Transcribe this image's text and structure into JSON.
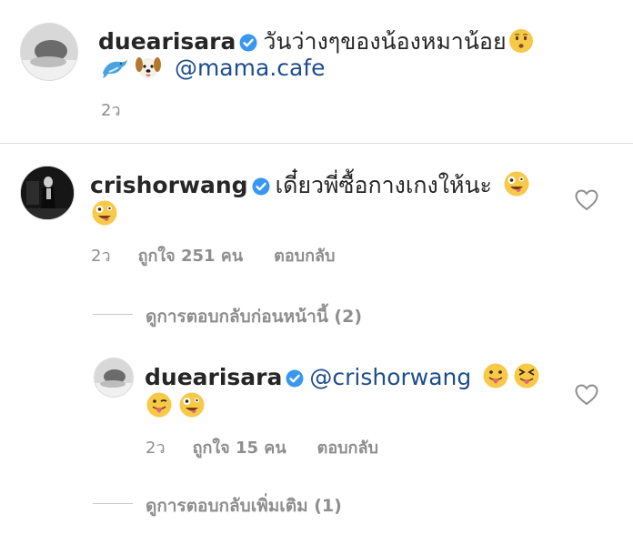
{
  "caption": {
    "username": "duearisara",
    "text": "วันว่างๆของน้องหมาน้อย",
    "mention": "@mama.cafe",
    "time": "2ว"
  },
  "comments": [
    {
      "username": "crishorwang",
      "text": "เดี๋ยวพี่ซื้อกางเกงให้นะ",
      "time": "2ว",
      "likes": "ถูกใจ 251 คน",
      "reply_label": "ตอบกลับ",
      "view_previous_replies": "ดูการตอบกลับก่อนหน้านี้ (2)"
    },
    {
      "username": "duearisara",
      "mention": "@crishorwang",
      "time": "2ว",
      "likes": "ถูกใจ 15 คน",
      "reply_label": "ตอบกลับ",
      "view_more_replies": "ดูการตอบกลับเพิ่มเติม (1)"
    }
  ],
  "colors": {
    "verified": "#3897f0",
    "mention": "#1f4e8c",
    "meta": "#8e8e8e",
    "divider": "#dbdbdb"
  },
  "icons": [
    "verified-badge-icon",
    "heart-outline-icon",
    "hushed-face-emoji",
    "dolphin-emoji",
    "dog-face-emoji",
    "zany-face-emoji",
    "tongue-out-emoji",
    "squinting-tongue-emoji",
    "winking-tongue-emoji"
  ]
}
